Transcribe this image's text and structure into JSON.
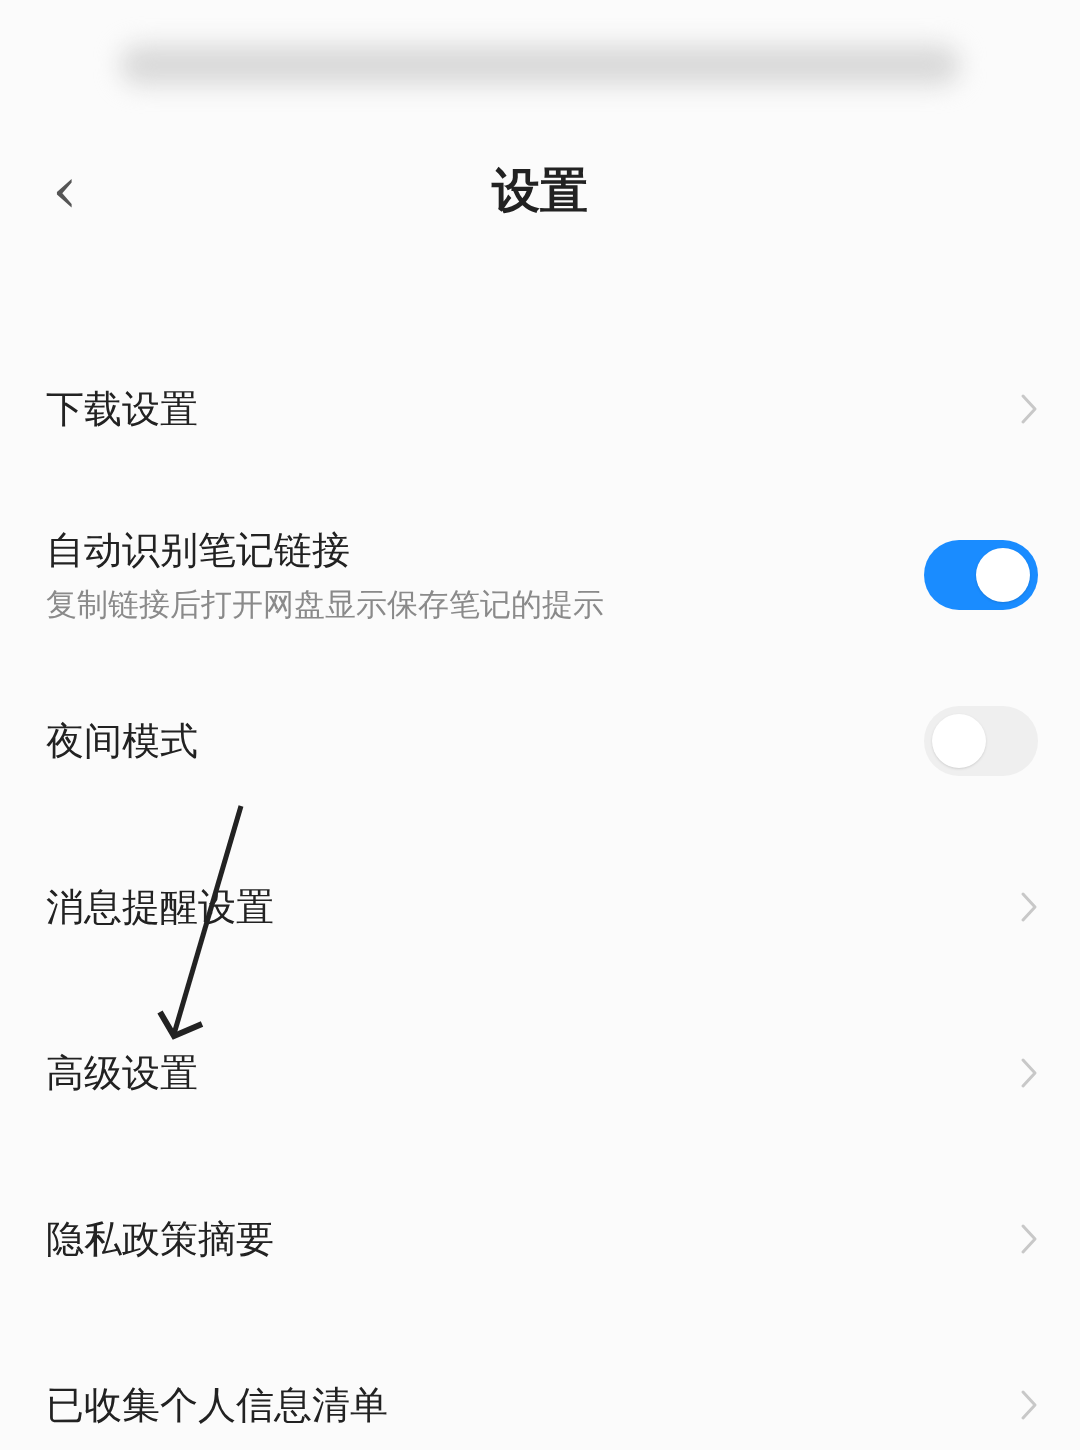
{
  "header": {
    "back": "‹",
    "title": "设置"
  },
  "items": [
    {
      "kind": "link",
      "label": "下载设置"
    },
    {
      "kind": "toggle",
      "label": "自动识别笔记链接",
      "subtitle": "复制链接后打开网盘显示保存笔记的提示",
      "on": true
    },
    {
      "kind": "toggle",
      "label": "夜间模式",
      "on": false
    },
    {
      "kind": "link",
      "label": "消息提醒设置"
    },
    {
      "kind": "link",
      "label": "高级设置"
    },
    {
      "kind": "link",
      "label": "隐私政策摘要"
    },
    {
      "kind": "link",
      "label": "已收集个人信息清单"
    }
  ]
}
